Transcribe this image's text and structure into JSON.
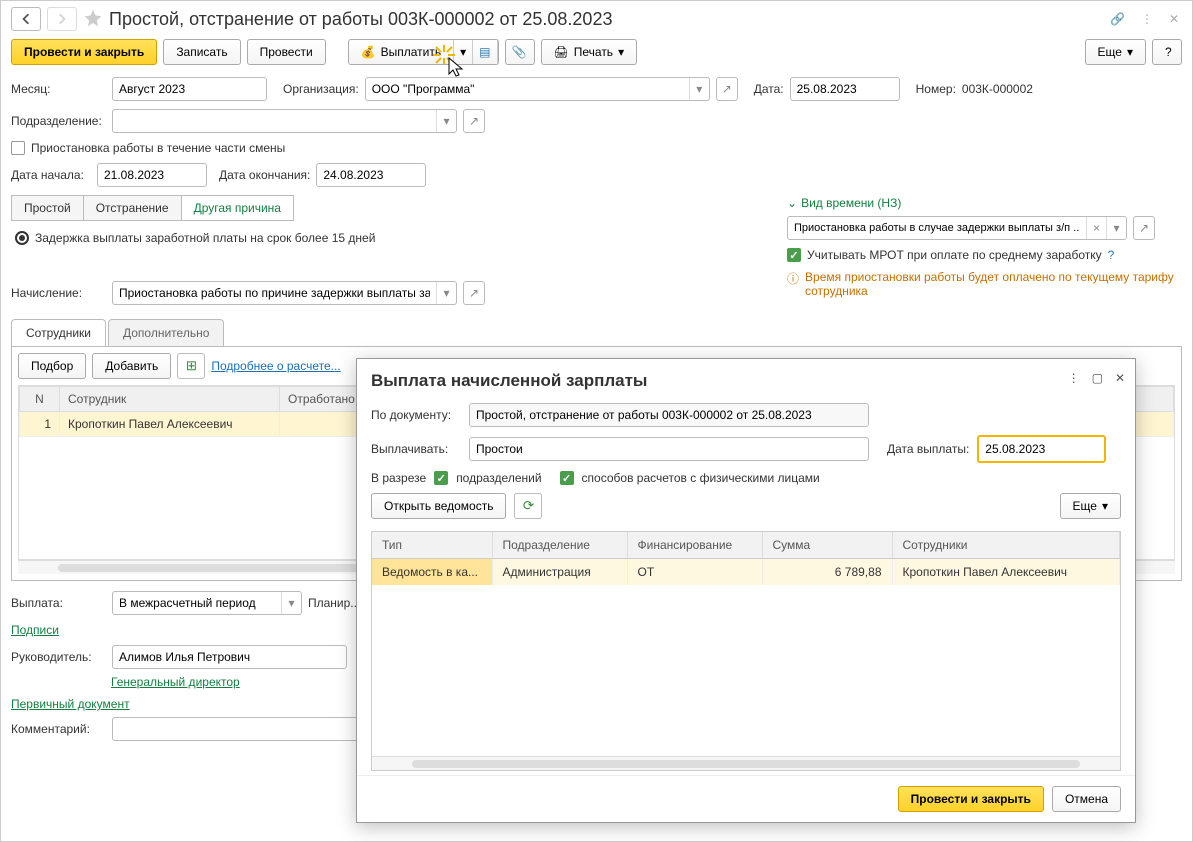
{
  "header": {
    "title": "Простой, отстранение от работы 003К-000002 от 25.08.2023"
  },
  "toolbar": {
    "post_close": "Провести и закрыть",
    "save": "Записать",
    "post": "Провести",
    "pay": "Выплатить",
    "print": "Печать",
    "more": "Еще",
    "help": "?"
  },
  "fields": {
    "month_label": "Месяц:",
    "month": "Август 2023",
    "org_label": "Организация:",
    "org": "ООО \"Программа\"",
    "date_label": "Дата:",
    "date": "25.08.2023",
    "number_label": "Номер:",
    "number": "003К-000002",
    "dept_label": "Подразделение:",
    "dept": "",
    "partial_shift": "Приостановка работы в течение части смены",
    "start_label": "Дата начала:",
    "start": "21.08.2023",
    "end_label": "Дата окончания:",
    "end": "24.08.2023"
  },
  "tabs": {
    "t1": "Простой",
    "t2": "Отстранение",
    "t3": "Другая причина"
  },
  "radio": "Задержка выплаты заработной платы на срок более 15 дней",
  "right": {
    "time_type": "Вид времени (НЗ)",
    "time_val": "Приостановка работы в случае задержки выплаты з/п ...",
    "mrot": "Учитывать МРОТ при оплате по среднему заработку",
    "info": "Время приостановки работы будет оплачено по текущему тарифу сотрудника"
  },
  "accrual": {
    "label": "Начисление:",
    "value": "Приостановка работы по причине задержки выплаты за..."
  },
  "subtabs": {
    "t1": "Сотрудники",
    "t2": "Дополнительно"
  },
  "subtoolbar": {
    "select": "Подбор",
    "add": "Добавить",
    "details": "Подробнее о расчете..."
  },
  "tbl": {
    "h1": "N",
    "h2": "Сотрудник",
    "h3": "Отработано",
    "r1_n": "1",
    "r1_name": "Кропоткин Павел Алексеевич"
  },
  "bottom": {
    "pay_label": "Выплата:",
    "pay_value": "В межрасчетный период",
    "plan_label": "Планир...",
    "signs": "Подписи",
    "head_label": "Руководитель:",
    "head_value": "Алимов Илья Петрович",
    "head_pos": "Генеральный директор",
    "primary_doc": "Первичный документ",
    "comment_label": "Комментарий:"
  },
  "modal": {
    "title": "Выплата начисленной зарплаты",
    "doc_label": "По документу:",
    "doc_value": "Простой, отстранение от работы 003К-000002 от 25.08.2023",
    "pay_label": "Выплачивать:",
    "pay_value": "Простои",
    "date_label": "Дата выплаты:",
    "date_value": "25.08.2023",
    "slice_label": "В разрезе",
    "chk1": "подразделений",
    "chk2": "способов расчетов с физическими лицами",
    "open": "Открыть ведомость",
    "more": "Еще",
    "th1": "Тип",
    "th2": "Подразделение",
    "th3": "Финансирование",
    "th4": "Сумма",
    "th5": "Сотрудники",
    "r1_type": "Ведомость в ка...",
    "r1_dept": "Администрация",
    "r1_fin": "ОТ",
    "r1_sum": "6 789,88",
    "r1_emp": "Кропоткин Павел Алексеевич",
    "ok": "Провести и закрыть",
    "cancel": "Отмена"
  }
}
